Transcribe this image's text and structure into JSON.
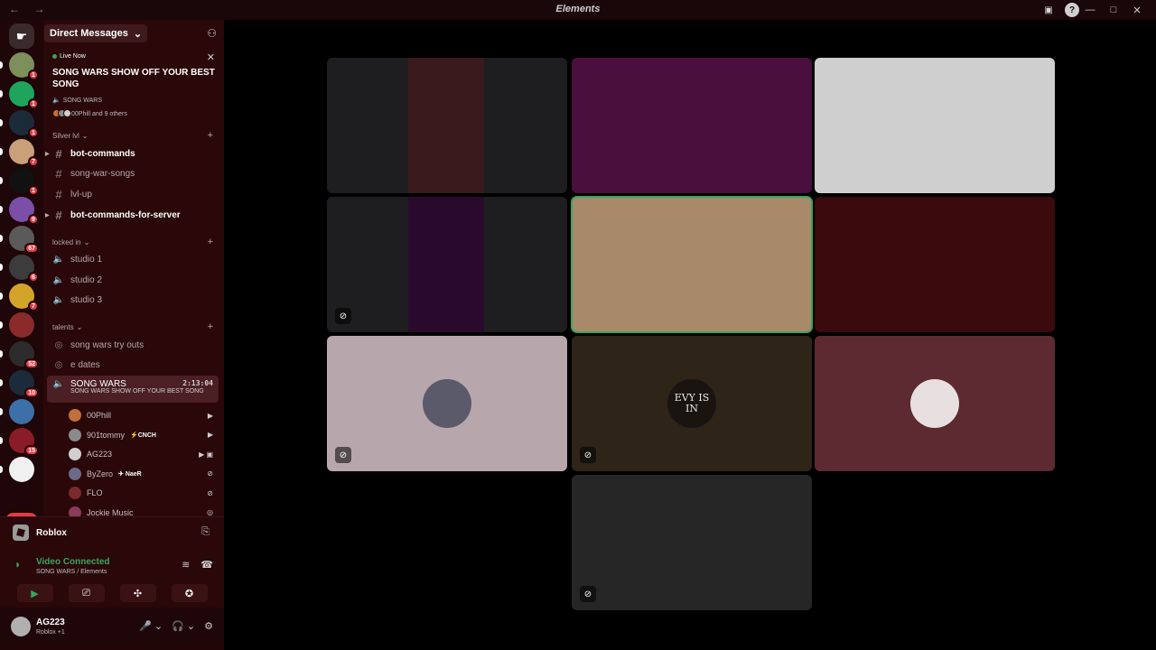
{
  "app": {
    "title": "Elements",
    "nav": "← →",
    "window_controls": [
      "—",
      "□",
      "✕"
    ],
    "titlebar_icons": [
      "inbox-icon",
      "help-icon"
    ]
  },
  "servers": [
    {
      "badge": "1",
      "color": "#7d8f5a"
    },
    {
      "badge": "1",
      "color": "#1fa55b"
    },
    {
      "badge": "1",
      "color": "#1c2b3a"
    },
    {
      "badge": "7",
      "color": "#c9a07a"
    },
    {
      "badge": "1",
      "color": "#111111"
    },
    {
      "badge": "9",
      "color": "#7b4fa8"
    },
    {
      "badge": "67",
      "color": "#5a5a5a"
    },
    {
      "badge": "6",
      "color": "#3c3c3c"
    },
    {
      "badge": "7",
      "color": "#d4a42a"
    },
    {
      "badge": "",
      "color": "#8a2a2a"
    },
    {
      "badge": "52",
      "color": "#2c2c2c"
    },
    {
      "badge": "10",
      "color": "#1c2b3a"
    },
    {
      "badge": "",
      "color": "#3d6fa8"
    },
    {
      "badge": "15",
      "color": "#8a1c28"
    },
    {
      "badge": "",
      "color": "#f0f0f0"
    }
  ],
  "new_label": "NEW",
  "dm": {
    "label": "Direct Messages",
    "chevron": "⌄"
  },
  "live": {
    "tag": "Live Now",
    "title": "SONG WARS SHOW OFF YOUR BEST SONG",
    "channel": "SONG WARS",
    "users": "00Phill and 9 others"
  },
  "categories": {
    "silver": "Silver lvl",
    "locked": "locked in",
    "talents": "talents"
  },
  "channels": {
    "bot_commands": "bot-commands",
    "song_war_songs": "song-war-songs",
    "lvl_up": "lvl-up",
    "bot_commands_server": "bot-commands-for-server",
    "studio1": "studio 1",
    "studio2": "studio 2",
    "studio3": "studio 3",
    "try_outs": "song wars try outs",
    "e_dates": "e dates",
    "song_wars": "SONG WARS",
    "song_wars_time": "2:13:04",
    "song_wars_stream": "SONG WARS SHOW OFF YOUR BEST SONG"
  },
  "voice_users": [
    {
      "name": "00Phill",
      "tag": "",
      "color": "#c0703a",
      "icon": "▶"
    },
    {
      "name": "901tommy",
      "tag": "⚡CNCH",
      "color": "#8a8a8a",
      "icon": "▶"
    },
    {
      "name": "AG223",
      "tag": "",
      "color": "#d0d0d0",
      "icon": "▶ ▣"
    },
    {
      "name": "ByZero",
      "tag": "✈ NaeR",
      "color": "#6a6a8a",
      "icon": "⊘"
    },
    {
      "name": "FLO",
      "tag": "",
      "color": "#7a2a2a",
      "icon": "⊘"
    },
    {
      "name": "Jockie Music",
      "tag": "",
      "color": "#8a3a5a",
      "icon": "◎"
    }
  ],
  "panel": {
    "activity": "Roblox",
    "vc_title": "Video Connected",
    "vc_sub": "SONG WARS / Elements",
    "user_name": "AG223",
    "user_status": "Roblox +1"
  },
  "tiles": [
    {
      "name": "tile-1",
      "bg": "#1e1e20",
      "mute": false
    },
    {
      "name": "tile-2",
      "bg": "#4a0f3c",
      "mute": false
    },
    {
      "name": "tile-3",
      "bg": "#cfcfd0",
      "mute": false
    },
    {
      "name": "tile-4",
      "bg": "#1e1e20",
      "mute": true
    },
    {
      "name": "tile-5",
      "bg": "#a88a6a",
      "mute": false
    },
    {
      "name": "tile-6",
      "bg": "#3a0a0c",
      "mute": false
    },
    {
      "name": "tile-7",
      "bg": "#b8a6ad",
      "mute": true
    },
    {
      "name": "tile-8",
      "bg": "#2e2418",
      "mute": true
    },
    {
      "name": "tile-9",
      "bg": "#5c2a30",
      "mute": false
    },
    {
      "name": "tile-10",
      "bg": "#262626",
      "mute": true
    }
  ],
  "tile_avatar_text": "EVY IS IN"
}
